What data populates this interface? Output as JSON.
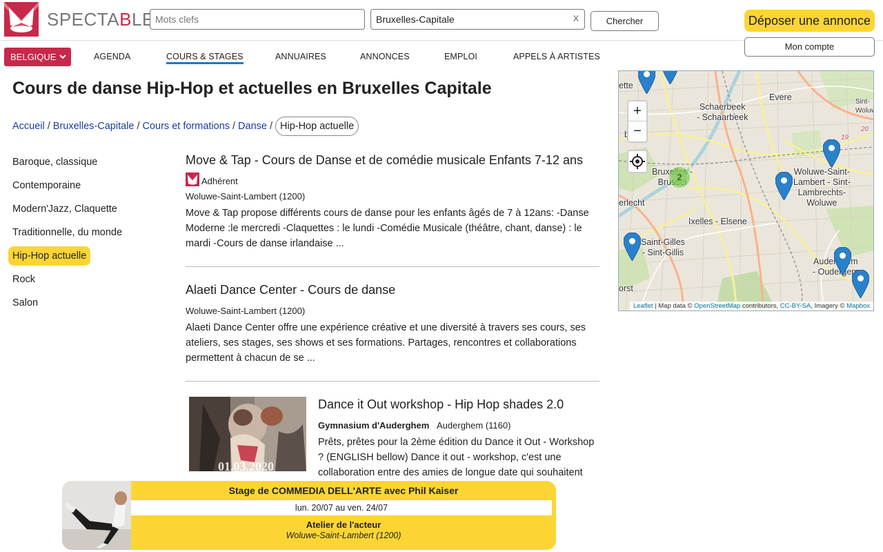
{
  "brand": {
    "name_part1": "SPECTA",
    "name_accent": "B",
    "name_part2": "LE",
    "accent_color": "#c8284a",
    "highlight_color": "#fcd535"
  },
  "search": {
    "keywords_placeholder": "Mots clefs",
    "location_value": "Bruxelles-Capitale",
    "clear_label": "x",
    "submit_label": "Chercher"
  },
  "header": {
    "post_ad_label": "Déposer une annonce",
    "account_label": "Mon compte"
  },
  "nav": {
    "country_label": "BELGIQUE",
    "country_icon": "chevron-down-icon",
    "items": [
      {
        "label": "AGENDA"
      },
      {
        "label": "COURS & STAGES",
        "active": true
      },
      {
        "label": "ANNUAIRES"
      },
      {
        "label": "ANNONCES"
      },
      {
        "label": "EMPLOI"
      },
      {
        "label": "APPELS À ARTISTES"
      }
    ]
  },
  "page": {
    "title": "Cours de danse Hip-Hop et actuelles en Bruxelles Capitale"
  },
  "breadcrumb": {
    "items": [
      "Accueil",
      "Bruxelles-Capitale",
      "Cours et formations",
      "Danse"
    ],
    "separator": "/",
    "current": "Hip-Hop actuelle"
  },
  "sidebar": {
    "items": [
      {
        "label": "Baroque, classique"
      },
      {
        "label": "Contemporaine"
      },
      {
        "label": "Modern'Jazz, Claquette"
      },
      {
        "label": "Traditionnelle, du monde"
      },
      {
        "label": "Hip-Hop actuelle",
        "active": true
      },
      {
        "label": "Rock"
      },
      {
        "label": "Salon"
      }
    ]
  },
  "listings": [
    {
      "title": "Move & Tap - Cours de Danse et de comédie musicale Enfants 7-12 ans",
      "badge": "Adhérent",
      "location": "Woluwe-Saint-Lambert (1200)",
      "description": "Move & Tap propose différents cours de danse pour les enfants âgés de 7 à 12ans: -Danse Moderne :le mercredi -Claquettes : le lundi -Comédie Musicale (théâtre, chant, danse) : le mardi -Cours de danse irlandaise ..."
    },
    {
      "title": "Alaeti Dance Center - Cours de danse",
      "location": "Woluwe-Saint-Lambert (1200)",
      "description": "Alaeti Dance Center offre une expérience créative et une diversité à travers ses cours, ses ateliers, ses stages, ses shows et ses formations. Partages, rencontres et collaborations permettent à chacun de se ..."
    },
    {
      "title": "Dance it Out workshop - Hip Hop shades 2.0",
      "venue": "Gymnasium d'Auderghem",
      "location": "Auderghem (1160)",
      "description": "Prêts, prêtes pour la 2ème édition du Dance it Out - Workshop ? (ENGLISH bellow) Dance it out - workshop, c'est une collaboration entre des amies de longue date qui souhaitent",
      "image_date_text": "01.03.2020"
    }
  ],
  "map": {
    "labels": [
      {
        "text": "Schaerbeek\n- Schaarbeek"
      },
      {
        "text": "Evere"
      },
      {
        "text": "Bruxelles -\nBrussel"
      },
      {
        "text": "Woluwe-Saint-\nLambert - Sint-\nLambrechts-\nWoluwe"
      },
      {
        "text": "Ixelles - Elsene"
      },
      {
        "text": "Saint-Gilles\n- Sint-Gillis"
      },
      {
        "text": "Auderghem\n- Oudergem"
      },
      {
        "text": "erlecht"
      },
      {
        "text": "berg"
      },
      {
        "text": "ette"
      },
      {
        "text": "Sint-\nWoluw"
      },
      {
        "text": "orst"
      }
    ],
    "road_numbers": [
      "19",
      "20"
    ],
    "cluster_count": "2",
    "zoom_in": "+",
    "zoom_out": "−",
    "locate_icon": "crosshair-icon",
    "attribution": {
      "leaflet": "Leaflet",
      "map_data": " | Map data © ",
      "osm": "OpenStreetMap",
      "contributors": " contributors, ",
      "license": "CC-BY-SA",
      "imagery": ", Imagery © ",
      "mapbox": "Mapbox"
    },
    "marker_color": "#2a81cb"
  },
  "promo": {
    "title": "Stage de COMMEDIA DELL'ARTE avec Phil Kaiser",
    "dates": "lun. 20/07 au ven. 24/07",
    "venue": "Atelier de l'acteur",
    "location": "Woluwe-Saint-Lambert (1200)"
  }
}
